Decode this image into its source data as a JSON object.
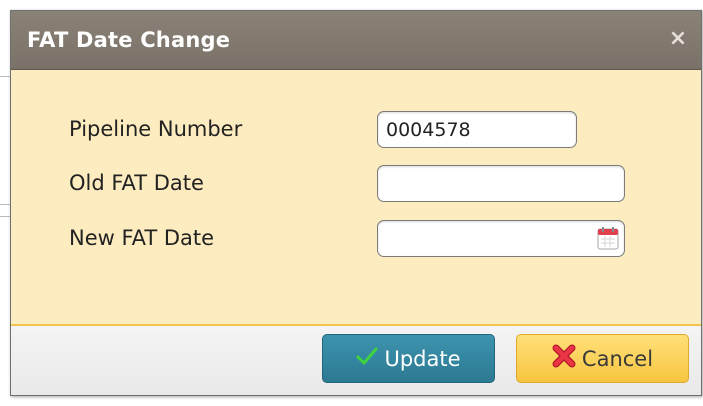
{
  "dialog": {
    "title": "FAT Date Change",
    "close_label": "×"
  },
  "form": {
    "pipeline_number_label": "Pipeline Number",
    "pipeline_number_value": "0004578",
    "old_fat_date_label": "Old FAT Date",
    "old_fat_date_value": "",
    "new_fat_date_label": "New FAT Date",
    "new_fat_date_value": ""
  },
  "footer": {
    "update_label": "Update",
    "cancel_label": "Cancel"
  },
  "icons": {
    "close": "close-icon",
    "calendar": "calendar-icon",
    "update": "checkmark-icon",
    "cancel": "x-mark-icon"
  },
  "colors": {
    "titlebar": "#7f766d",
    "content_bg": "#fdecbf",
    "update_button": "#3289a3",
    "cancel_button": "#fbd35b",
    "check_green": "#2fbf2f",
    "cancel_red": "#e0283a"
  }
}
